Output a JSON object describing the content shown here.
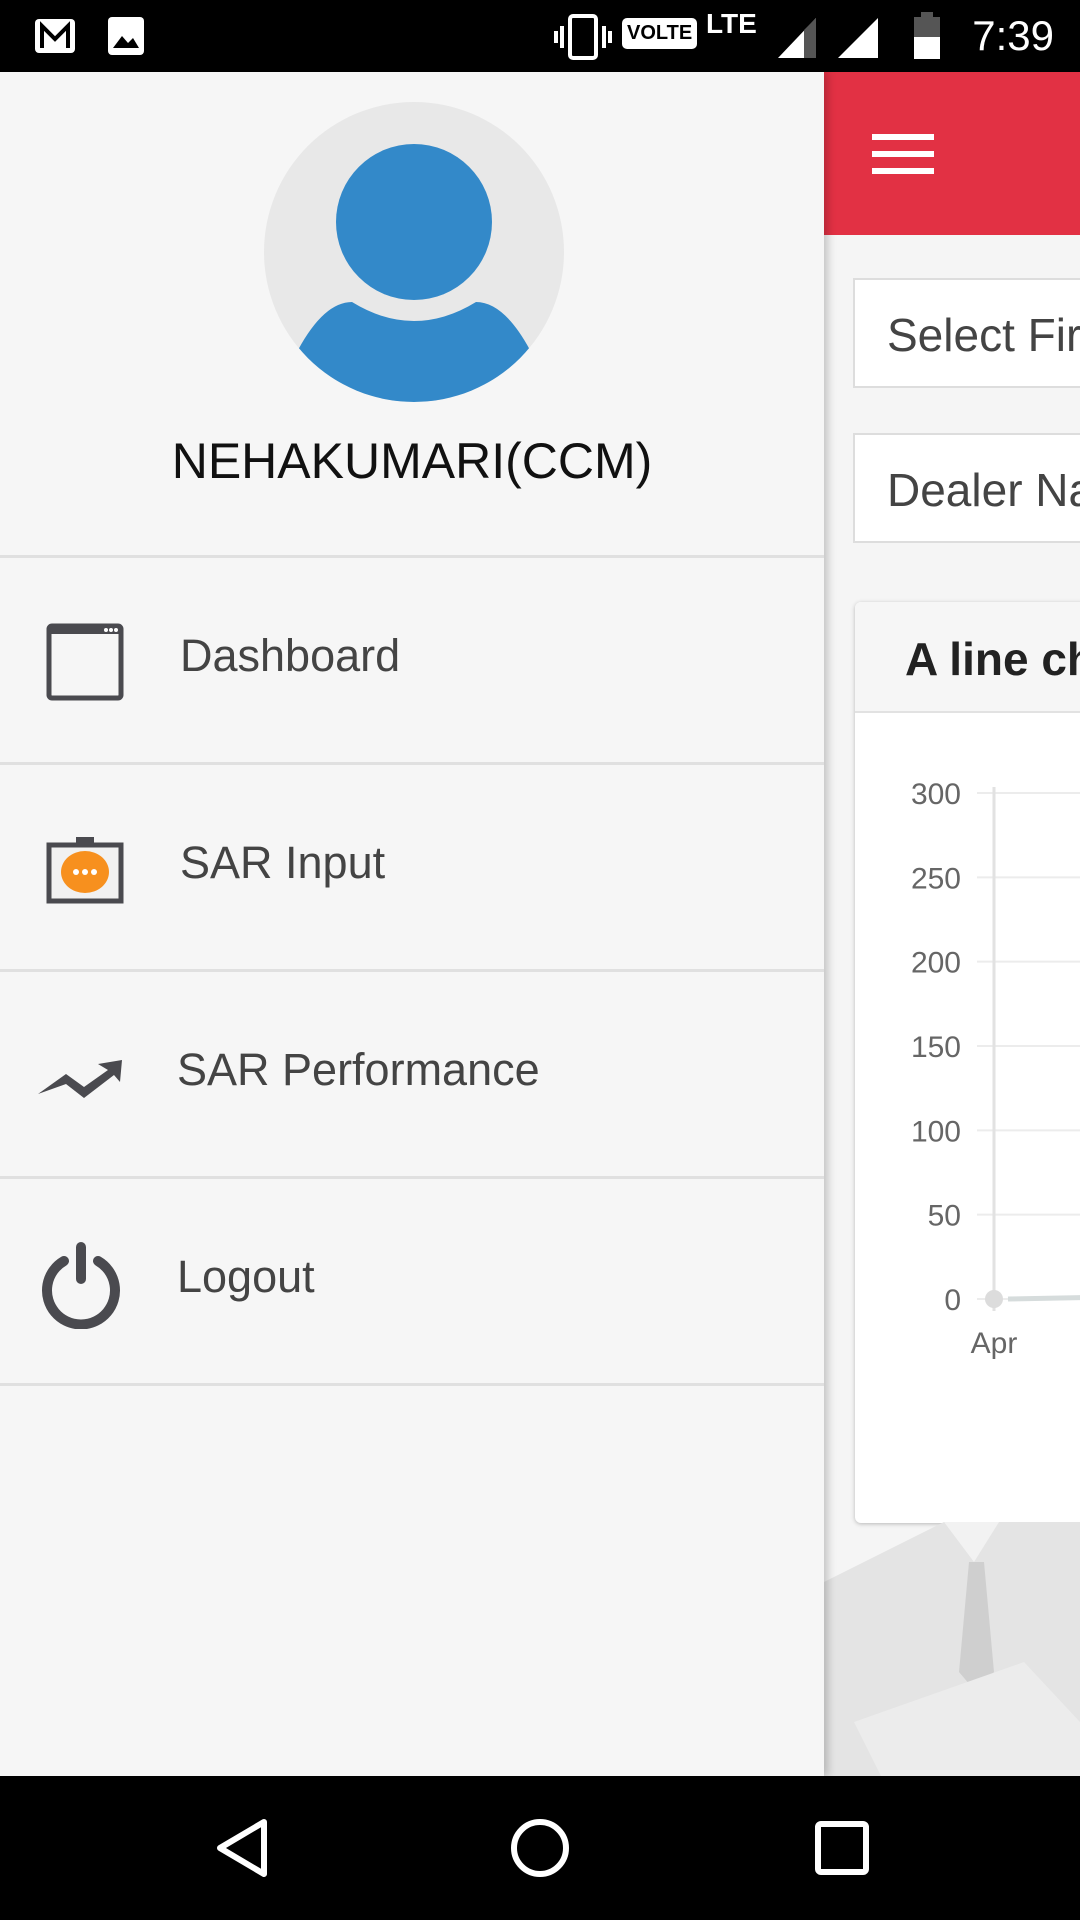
{
  "status_bar": {
    "time": "7:39",
    "network": "LTE",
    "volte": "VOLTE",
    "icons": [
      "gmail-icon",
      "gallery-icon",
      "vibrate-icon",
      "signal-icon",
      "battery-icon"
    ]
  },
  "drawer": {
    "user_name": "NEHAKUMARI(CCM)",
    "items": [
      {
        "label": "Dashboard",
        "icon": "dashboard-window-icon"
      },
      {
        "label": "SAR Input",
        "icon": "sar-input-icon"
      },
      {
        "label": "SAR Performance",
        "icon": "trending-up-icon"
      },
      {
        "label": "Logout",
        "icon": "power-icon"
      }
    ],
    "accent": "#3389c9",
    "badge_color": "#f7901e"
  },
  "main": {
    "header_color": "#e23144",
    "select_field": "Select Fir",
    "dealer_field": "Dealer Na",
    "card_title": "A line ch"
  },
  "chart_data": {
    "type": "line",
    "title": "A line ch",
    "y_ticks": [
      "300",
      "250",
      "200",
      "150",
      "100",
      "50",
      "0"
    ],
    "ylim": [
      0,
      300
    ],
    "categories": [
      "Apr"
    ],
    "values": [
      0
    ],
    "grid": true
  },
  "nav_bar": {
    "buttons": [
      "back",
      "home",
      "recents"
    ]
  }
}
